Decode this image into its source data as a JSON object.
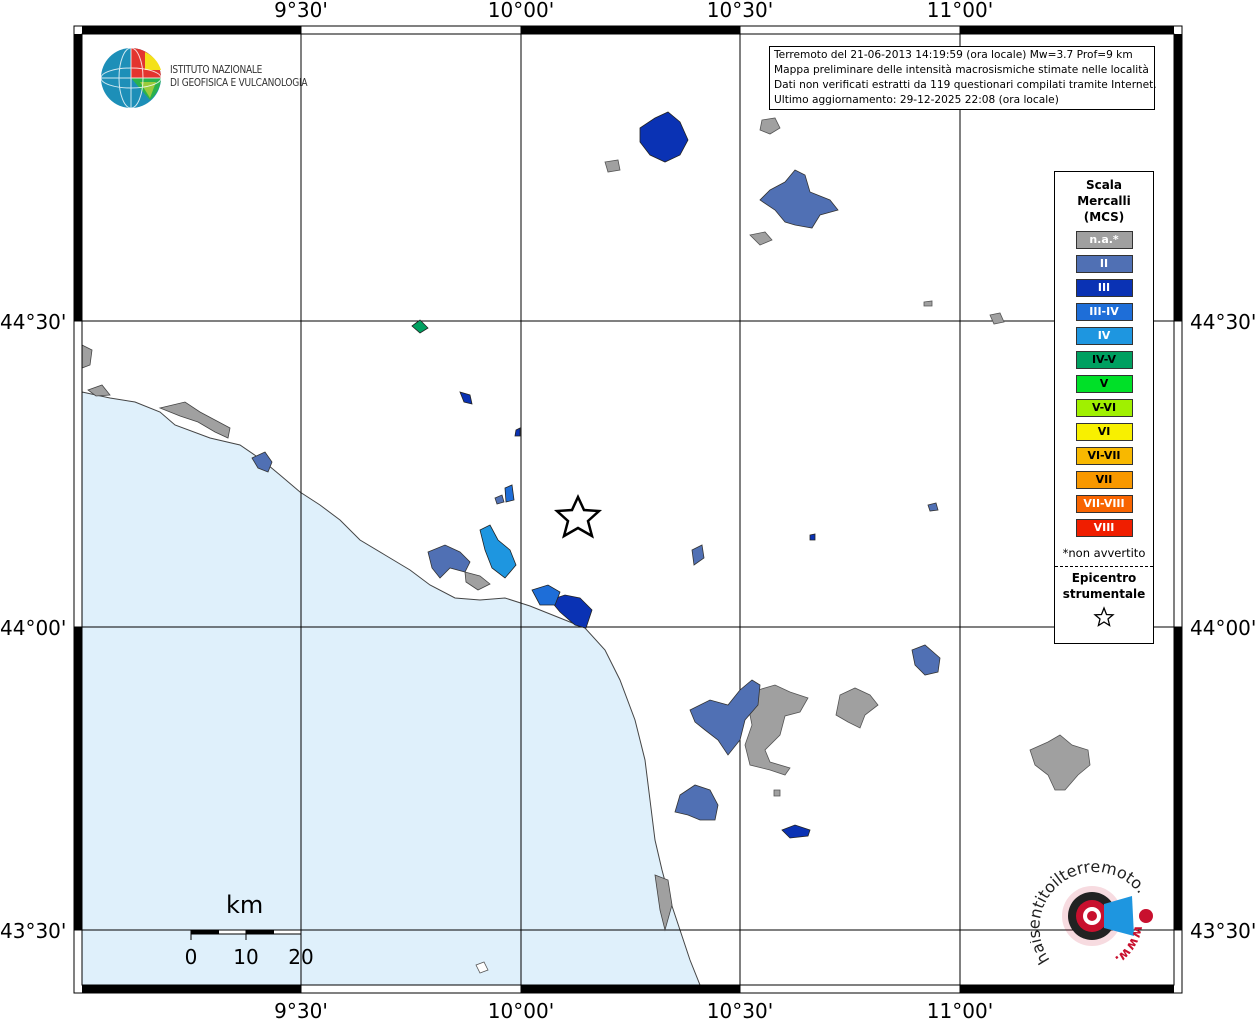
{
  "map": {
    "lon_labels": [
      "9°30'",
      "10°00'",
      "10°30'",
      "11°00'"
    ],
    "lat_labels": [
      "44°30'",
      "44°00'",
      "43°30'"
    ],
    "colors": {
      "sea": "#dff0fb",
      "grid": "#000000",
      "na": "#a0a0a0",
      "II": "#5070b4",
      "III": "#0a32b4",
      "III-IV": "#1e6ed8",
      "IV": "#1e96e0",
      "IV-V": "#00a060",
      "V": "#00e028",
      "V-VI": "#a0f000",
      "VI": "#f8f000",
      "VI-VII": "#f8b800",
      "VII": "#f89800",
      "VII-VIII": "#f86400",
      "VIII": "#f01e00"
    }
  },
  "info": {
    "line1": "Terremoto del 21-06-2013 14:19:59 (ora locale) Mw=3.7 Prof=9 km",
    "line2": "Mappa preliminare delle intensità macrosismiche stimate nelle località",
    "line3": "Dati non verificati estratti da 119 questionari compilati tramite Internet.",
    "line4": "Ultimo aggiornamento: 29-12-2025 22:08 (ora locale)"
  },
  "legend": {
    "title1": "Scala",
    "title2": "Mercalli",
    "title3": "(MCS)",
    "items": [
      {
        "label": "n.a.*",
        "color": "#a0a0a0"
      },
      {
        "label": "II",
        "color": "#5070b4"
      },
      {
        "label": "III",
        "color": "#0a32b4"
      },
      {
        "label": "III-IV",
        "color": "#1e6ed8"
      },
      {
        "label": "IV",
        "color": "#1e96e0"
      },
      {
        "label": "IV-V",
        "color": "#00a060"
      },
      {
        "label": "V",
        "color": "#00e028"
      },
      {
        "label": "V-VI",
        "color": "#a0f000"
      },
      {
        "label": "VI",
        "color": "#f8f000"
      },
      {
        "label": "VI-VII",
        "color": "#f8b800"
      },
      {
        "label": "VII",
        "color": "#f89800"
      },
      {
        "label": "VII-VIII",
        "color": "#f86400"
      },
      {
        "label": "VIII",
        "color": "#f01e00"
      }
    ],
    "note": "*non avvertito",
    "epi1": "Epicentro",
    "epi2": "strumentale"
  },
  "logo": {
    "line1": "ISTITUTO NAZIONALE",
    "line2": "DI GEOFISICA E VULCANOLOGIA"
  },
  "scale": {
    "unit": "km",
    "ticks": [
      "0",
      "10",
      "20"
    ]
  },
  "hst": {
    "text": "haisentitoilterremoto.it",
    "www": "www."
  }
}
